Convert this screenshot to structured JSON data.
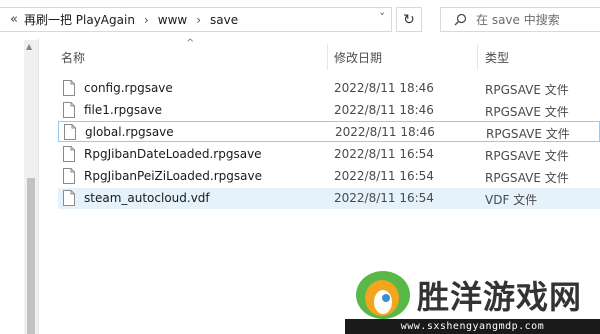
{
  "address": {
    "back_chevron": "«",
    "crumbs": [
      "再刷一把 PlayAgain",
      "www",
      "save"
    ],
    "separator": "›",
    "dropdown": "˅",
    "refresh": "↻"
  },
  "search": {
    "placeholder": "在 save 中搜索",
    "icon": "search-icon"
  },
  "columns": {
    "name": "名称",
    "date": "修改日期",
    "type": "类型",
    "sort_indicator": "^"
  },
  "files": [
    {
      "name": "config.rpgsave",
      "date": "2022/8/11 18:46",
      "type": "RPGSAVE 文件"
    },
    {
      "name": "file1.rpgsave",
      "date": "2022/8/11 18:46",
      "type": "RPGSAVE 文件"
    },
    {
      "name": "global.rpgsave",
      "date": "2022/8/11 18:46",
      "type": "RPGSAVE 文件"
    },
    {
      "name": "RpgJibanDateLoaded.rpgsave",
      "date": "2022/8/11 16:54",
      "type": "RPGSAVE 文件"
    },
    {
      "name": "RpgJibanPeiZiLoaded.rpgsave",
      "date": "2022/8/11 16:54",
      "type": "RPGSAVE 文件"
    },
    {
      "name": "steam_autocloud.vdf",
      "date": "2022/8/11 16:54",
      "type": "VDF 文件"
    }
  ],
  "focused_row": 2,
  "selected_row": 5,
  "watermark": {
    "title": "胜洋游戏网",
    "url": "www.sxshengyangmdp.com"
  },
  "colors": {
    "selection": "#e5f1fb",
    "focus_border": "#99c9ef",
    "folder": "#e8c34a"
  }
}
